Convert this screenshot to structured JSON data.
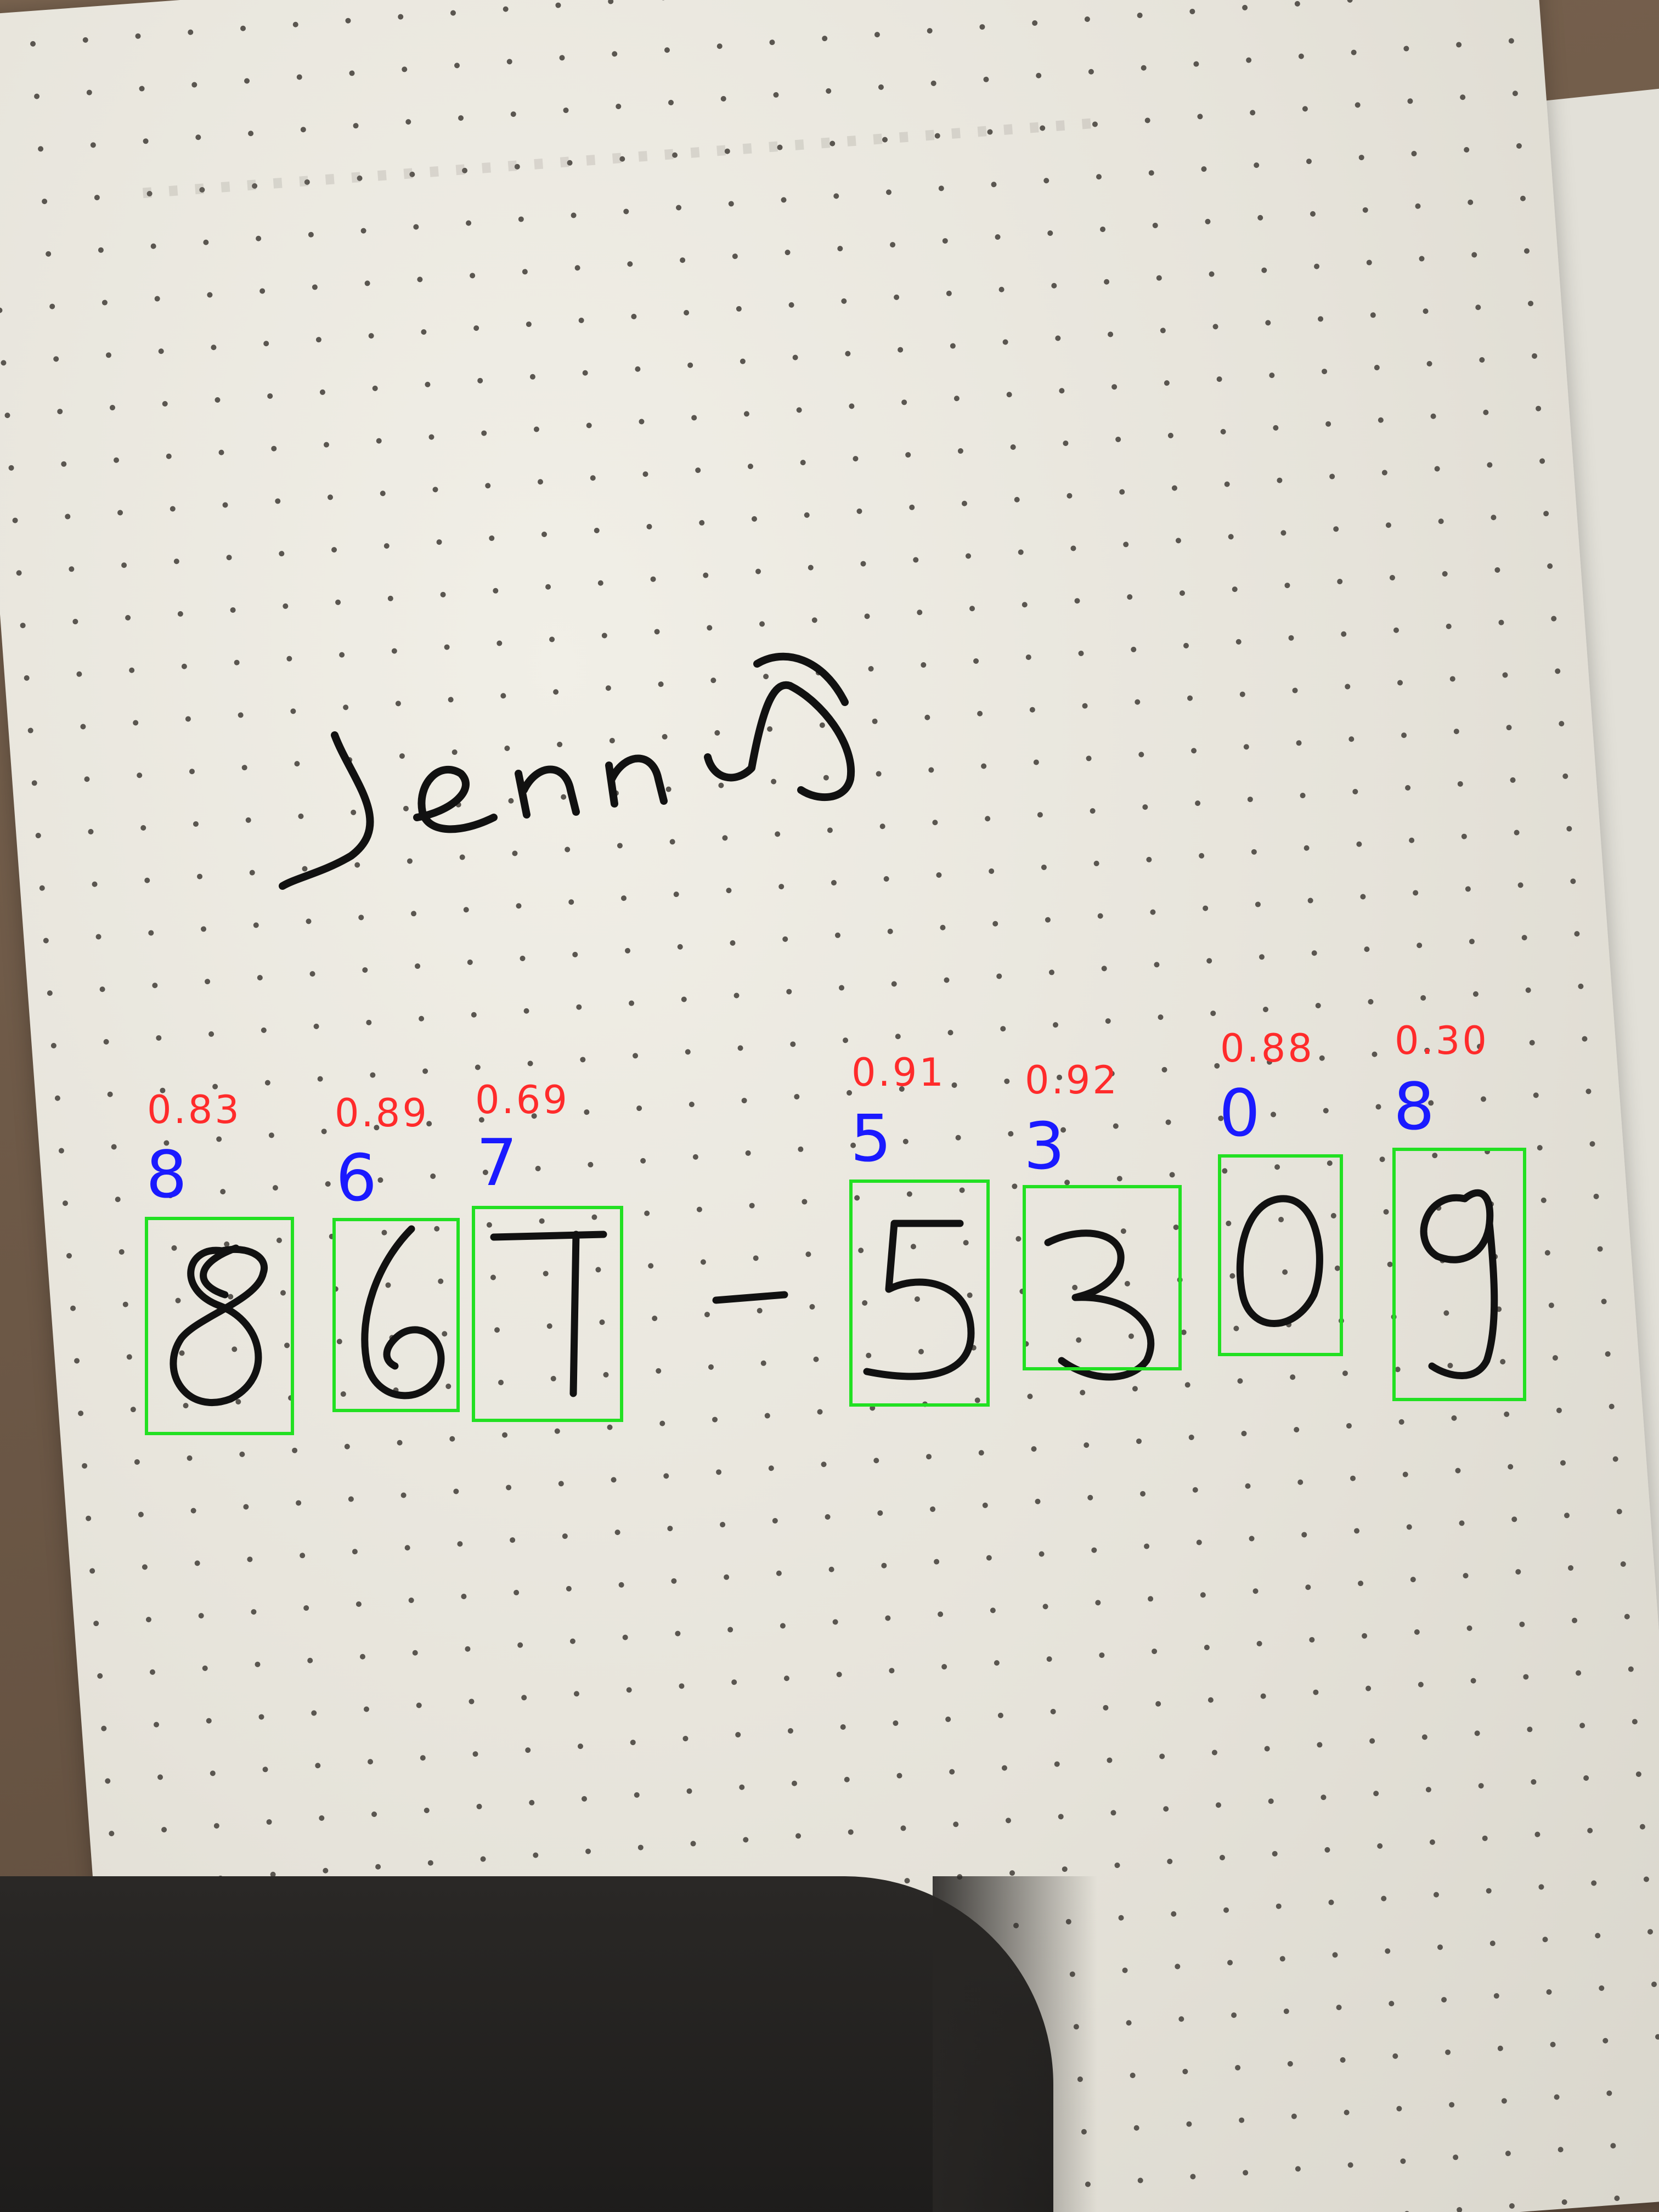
{
  "handwriting": {
    "name": "Jenny",
    "dash": "-"
  },
  "detections": [
    {
      "digit": "8",
      "label": "8",
      "score": "0.83"
    },
    {
      "digit": "6",
      "label": "6",
      "score": "0.89"
    },
    {
      "digit": "7",
      "label": "7",
      "score": "0.69"
    },
    {
      "digit": "5",
      "label": "5",
      "score": "0.91"
    },
    {
      "digit": "3",
      "label": "3",
      "score": "0.92"
    },
    {
      "digit": "0",
      "label": "0",
      "score": "0.88"
    },
    {
      "digit": "9",
      "label": "8",
      "score": "0.30"
    }
  ],
  "colors": {
    "box": "#22e022",
    "label": "#1a1aff",
    "score": "#ff2b2b",
    "ink": "#111111"
  }
}
